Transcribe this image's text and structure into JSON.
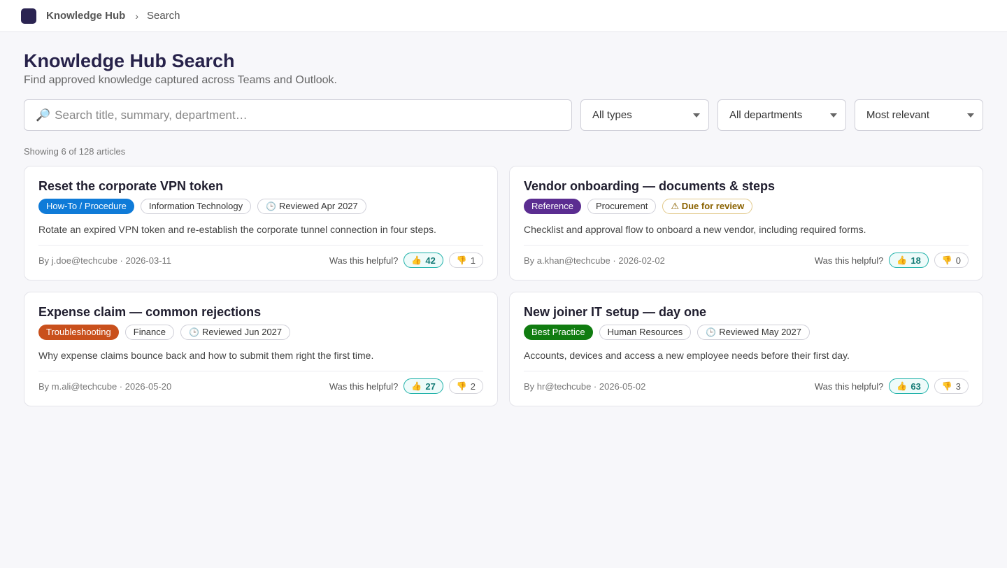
{
  "nav": {
    "brand": "Knowledge Hub",
    "separator": "›",
    "crumb": "Search"
  },
  "header": {
    "title": "Knowledge Hub Search",
    "subtitle": "Find approved knowledge captured across Teams and Outlook."
  },
  "filters": {
    "search_placeholder": "Search title, summary, department…",
    "search_value": "",
    "type": "All types",
    "department": "All departments",
    "sort": "Most relevant"
  },
  "results_label": "Showing 6 of 128 articles",
  "helpful_label": "Was this helpful?",
  "icons": {
    "search": "magnifier-icon",
    "clock": "clock-icon",
    "warning": "warning-icon",
    "thumbs_up": "thumbs-up-icon",
    "thumbs_down": "thumbs-down-icon"
  },
  "colors": {
    "howto": "#0f7bd8",
    "reference": "#5b2d91",
    "troubleshooting": "#c9501c",
    "bestpractice": "#107c10",
    "brand": "#2b2452"
  },
  "articles": [
    {
      "title": "Reset the corporate VPN token",
      "type": "How-To / Procedure",
      "department": "Information Technology",
      "review": "Reviewed Apr 2027",
      "summary": "Rotate an expired VPN token and re-establish the corporate tunnel connection in four steps.",
      "byline": "By j.doe@techcube · 2026-03-11",
      "up": "42",
      "down": "1"
    },
    {
      "title": "Vendor onboarding — documents & steps",
      "type": "Reference",
      "department": "Procurement",
      "review": "Due for review",
      "summary": "Checklist and approval flow to onboard a new vendor, including required forms.",
      "byline": "By a.khan@techcube · 2026-02-02",
      "up": "18",
      "down": "0"
    },
    {
      "title": "Expense claim — common rejections",
      "type": "Troubleshooting",
      "department": "Finance",
      "review": "Reviewed Jun 2027",
      "summary": "Why expense claims bounce back and how to submit them right the first time.",
      "byline": "By m.ali@techcube · 2026-05-20",
      "up": "27",
      "down": "2"
    },
    {
      "title": "New joiner IT setup — day one",
      "type": "Best Practice",
      "department": "Human Resources",
      "review": "Reviewed May 2027",
      "summary": "Accounts, devices and access a new employee needs before their first day.",
      "byline": "By hr@techcube · 2026-05-02",
      "up": "63",
      "down": "3"
    }
  ]
}
